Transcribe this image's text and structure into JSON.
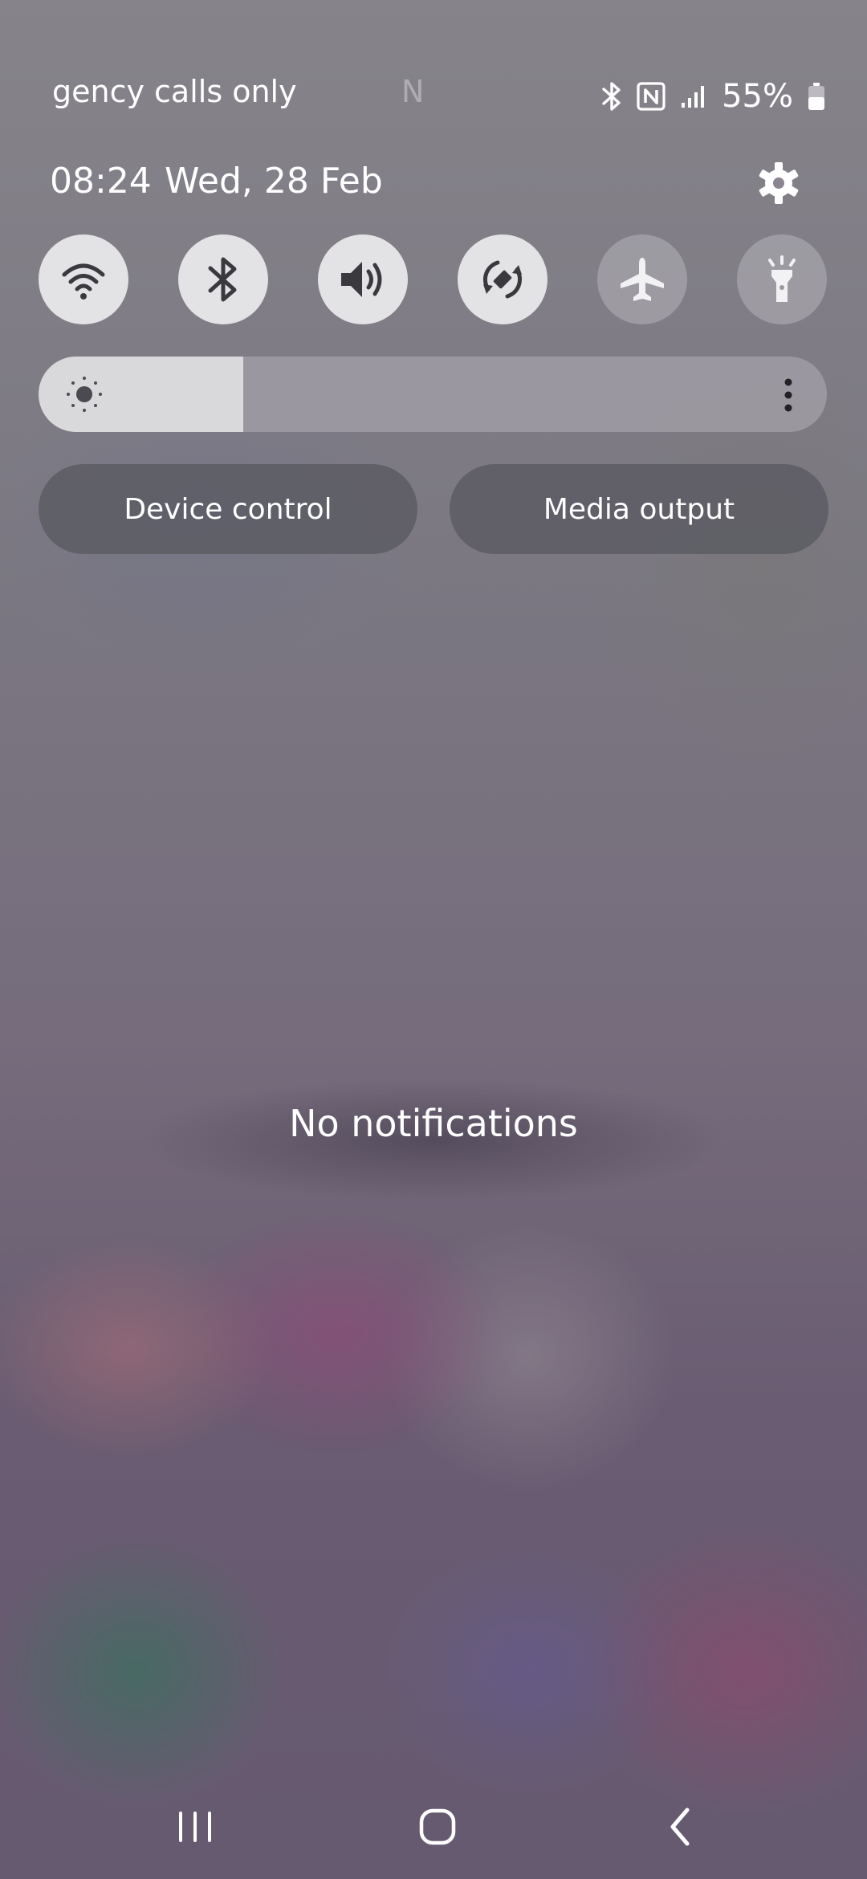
{
  "status_bar": {
    "carrier_fade": "",
    "carrier": "gency calls only",
    "faded_letter": "N",
    "battery_percent": "55%",
    "icons": [
      "bluetooth-icon",
      "nfc-icon",
      "signal-icon",
      "battery-icon"
    ]
  },
  "header": {
    "time": "08:24",
    "date": "Wed, 28 Feb",
    "settings_icon": "gear-icon"
  },
  "quick_tiles": [
    {
      "name": "wifi",
      "icon": "wifi-icon",
      "state": "on"
    },
    {
      "name": "bluetooth",
      "icon": "bluetooth-icon",
      "state": "on"
    },
    {
      "name": "sound",
      "icon": "volume-icon",
      "state": "on"
    },
    {
      "name": "auto-rotate",
      "icon": "rotate-icon",
      "state": "on"
    },
    {
      "name": "airplane-mode",
      "icon": "airplane-icon",
      "state": "off"
    },
    {
      "name": "flashlight",
      "icon": "flashlight-icon",
      "state": "off"
    }
  ],
  "brightness": {
    "level": 0.26,
    "icon": "brightness-icon",
    "menu_icon": "more-vertical-icon"
  },
  "buttons": {
    "device_control": "Device control",
    "media_output": "Media output"
  },
  "notifications": {
    "empty_text": "No notifications"
  },
  "nav_bar": {
    "icons": [
      "recent-apps-icon",
      "home-icon",
      "back-icon"
    ]
  },
  "colors": {
    "tile_on": "#e3e3e6",
    "tile_icon_on": "#3a3a3e",
    "tile_icon_off": "#f2f2f4",
    "brightness_fill": "#d9d9db"
  }
}
